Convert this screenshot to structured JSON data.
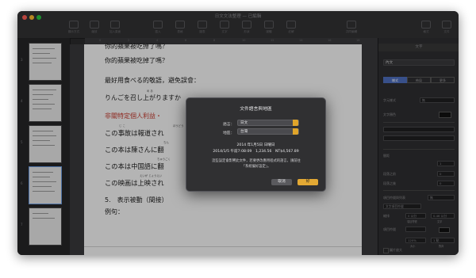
{
  "window": {
    "title": "日文文法整理 — 已編輯"
  },
  "colors": {
    "close": "#ff5f57",
    "minimize": "#febc2e",
    "zoom": "#28c840",
    "accent": "#e3a934",
    "tab_active": "#4e6fbf",
    "red_text": "#c53a2e"
  },
  "toolbar": {
    "items": [
      {
        "label": "顯示方式",
        "icon": "view-icon"
      },
      {
        "label": "縮放",
        "icon": "zoom-icon"
      },
      {
        "label": "加入頁面",
        "icon": "add-page-icon"
      },
      {
        "label": "插入",
        "icon": "insert-icon"
      },
      {
        "label": "表格",
        "icon": "table-icon"
      },
      {
        "label": "圖表",
        "icon": "chart-icon"
      },
      {
        "label": "文字",
        "icon": "text-icon"
      },
      {
        "label": "形狀",
        "icon": "shape-icon"
      },
      {
        "label": "媒體",
        "icon": "media-icon"
      },
      {
        "label": "註解",
        "icon": "comment-icon"
      },
      {
        "label": "共同編輯",
        "icon": "collaborate-icon"
      },
      {
        "label": "格式",
        "icon": "format-icon"
      },
      {
        "label": "文件",
        "icon": "document-icon"
      }
    ]
  },
  "ruler": {
    "ticks": [
      "0",
      "2",
      "4",
      "6",
      "8",
      "10",
      "12",
      "14",
      "16",
      "18"
    ]
  },
  "thumbnails": {
    "pages": [
      "3",
      "4",
      "5",
      "6",
      "7"
    ]
  },
  "document": {
    "lines": [
      {
        "text": "你的蘋果被吃掉了嗎？",
        "style": "normal"
      },
      {
        "text": "你的蘋果被吃掉了嗎？",
        "style": "normal"
      },
      {
        "text": "最好用食べる的敬語，避免誤會：",
        "style": "normal"
      },
      {
        "text": "りんごを召し上がりますか",
        "style": "normal"
      },
      {
        "text": "非關特定個人利益・",
        "style": "red"
      },
      {
        "text": "この事故は報道され",
        "style": "big"
      },
      {
        "text": "この本は陳さんに翻",
        "style": "big"
      },
      {
        "text": "この本は中国語に翻",
        "style": "big"
      },
      {
        "text": "この映画は上映され",
        "style": "big"
      },
      {
        "text": "5.　表示被動（間接）",
        "style": "normal"
      },
      {
        "text": "例句：",
        "style": "normal"
      }
    ],
    "ruby": [
      "ほうどう",
      "ちん",
      "ちゅうごく",
      "えいが じょうえい",
      "め あ",
      "じ こ"
    ]
  },
  "inspector": {
    "header": "文字",
    "style_name": "內文",
    "tabs": [
      "樣式",
      "佈局",
      "更多"
    ],
    "font_label": "字元樣式",
    "font_value": "無",
    "text_color_label": "文字顏色",
    "spacing_label": "間距",
    "spacing_value": "1",
    "before_label": "段落之前",
    "before_value": "0",
    "after_label": "段落之後",
    "after_value": "0",
    "bullets_label": "項目符號與列表",
    "bullets_value": "無",
    "list_style_label": "文字項目符號",
    "indent_label": "縮排",
    "indent_first": "0 公分",
    "indent_first_sub": "項目符號",
    "indent_text": "0.46 公分",
    "indent_text_sub": "文字",
    "bullet_label": "項目符號",
    "size_label": "大小",
    "size_value": "120%",
    "align_label": "對齊",
    "align_value": "1 點",
    "tiered_label": "層級數字",
    "bigger_label": "圖片放大"
  },
  "dialog": {
    "title": "文件語言與地區",
    "language_label": "語言：",
    "language_value": "日文",
    "region_label": "地區：",
    "region_value": "台灣",
    "sample_line1": "2014 年1月5日 日曜日",
    "sample_line2": "2014/1/5 午前7:08:09　1,234.56　NT$4,567.89",
    "note": "這些設定會影響此文件，若要更改應用程式的語言，請前往「系統偏好設定」。",
    "cancel_label": "取消",
    "ok_label": "好"
  }
}
